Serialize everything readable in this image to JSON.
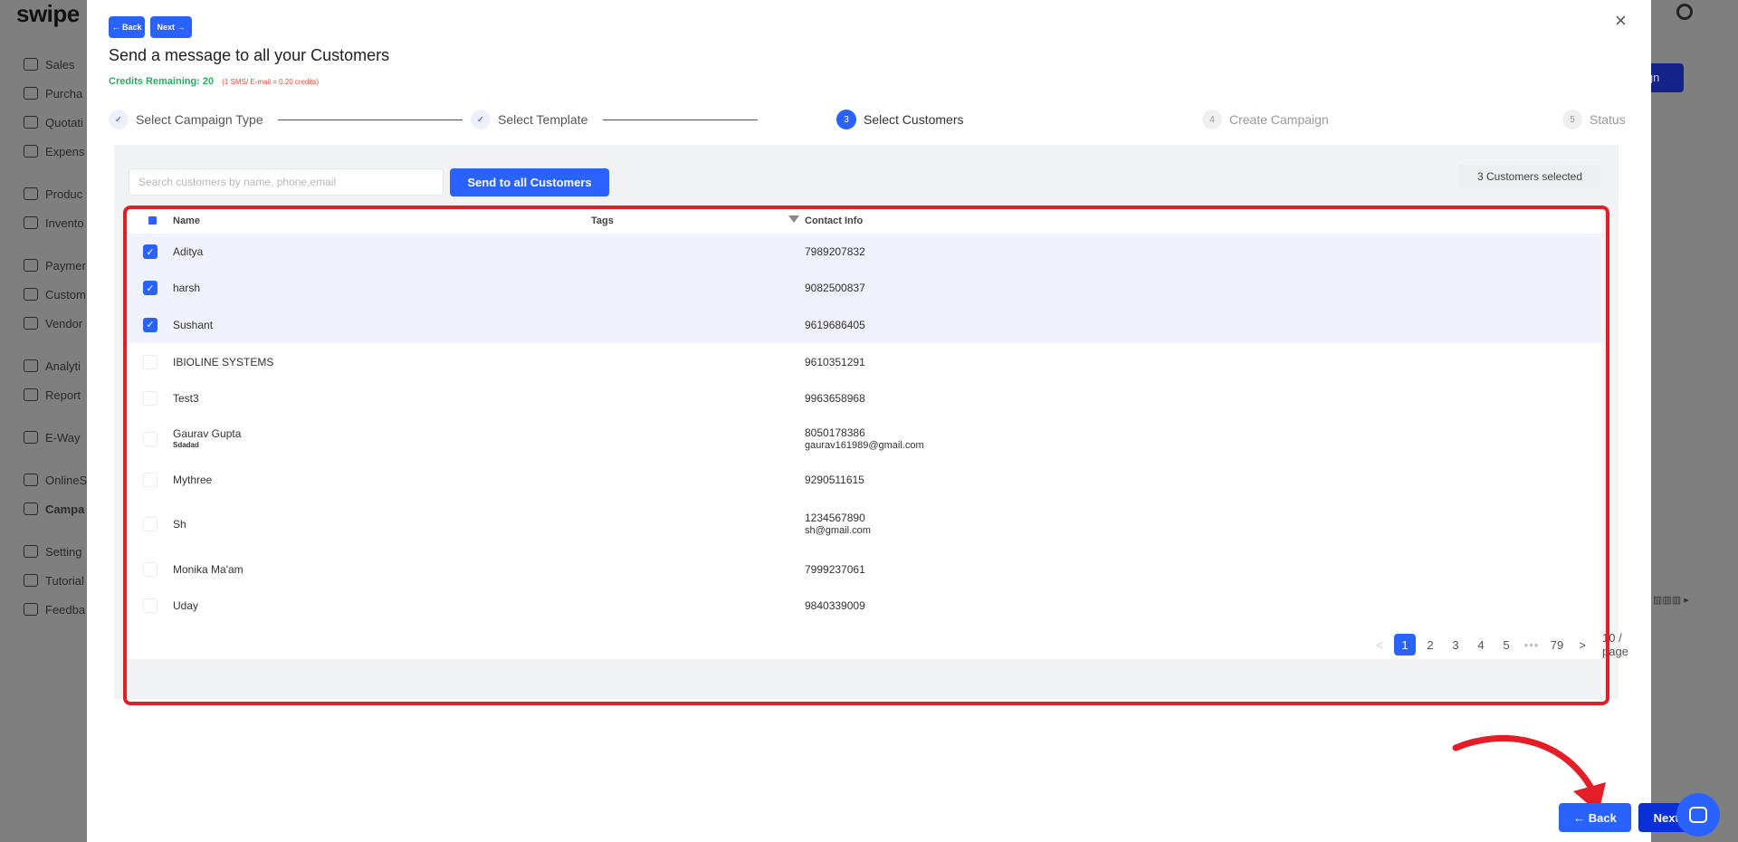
{
  "app": {
    "logo": "swipe :"
  },
  "sidebar": {
    "items": [
      {
        "label": "Sales",
        "icon": "sales-icon"
      },
      {
        "label": "Purcha",
        "icon": "cart-icon"
      },
      {
        "label": "Quotati",
        "icon": "pen-icon"
      },
      {
        "label": "Expens",
        "icon": "tag-icon"
      },
      {
        "label": "Produc",
        "icon": "scan-icon"
      },
      {
        "label": "Invento",
        "icon": "inventory-icon"
      },
      {
        "label": "Paymer",
        "icon": "rupee-icon"
      },
      {
        "label": "Custom",
        "icon": "user-icon"
      },
      {
        "label": "Vendor",
        "icon": "users-icon"
      },
      {
        "label": "Analyti",
        "icon": "chart-icon"
      },
      {
        "label": "Report",
        "icon": "report-icon"
      },
      {
        "label": "E-Way",
        "icon": "truck-icon"
      },
      {
        "label": "OnlineS",
        "icon": "store-icon"
      },
      {
        "label": "Campa",
        "icon": "megaphone-icon"
      },
      {
        "label": "Setting",
        "icon": "gear-icon"
      },
      {
        "label": "Tutorial",
        "icon": "youtube-icon"
      },
      {
        "label": "Feedba",
        "icon": "feedback-icon"
      }
    ]
  },
  "background": {
    "right_button_label": "ign"
  },
  "modal": {
    "top_back_label": "← Back",
    "top_next_label": "Next →",
    "close_label": "×",
    "title": "Send a message to all your Customers",
    "credits_label": "Credits Remaining: 20",
    "credits_note": "(1 SMS/ E-mail = 0.20 credits)",
    "steps": [
      {
        "label": "Select Campaign Type",
        "marker": "✓",
        "status": "done"
      },
      {
        "label": "Select Template",
        "marker": "✓",
        "status": "done"
      },
      {
        "label": "Select Customers",
        "marker": "3",
        "status": "active"
      },
      {
        "label": "Create Campaign",
        "marker": "4",
        "status": "todo"
      },
      {
        "label": "Status",
        "marker": "5",
        "status": "todo"
      }
    ],
    "search_placeholder": "Search customers by name, phone,email",
    "send_all_label": "Send to all Customers",
    "selected_count_label": "3 Customers selected",
    "table": {
      "headers": {
        "name": "Name",
        "tags": "Tags",
        "contact": "Contact Info"
      },
      "rows": [
        {
          "name": "Aditya",
          "tag": "",
          "phone": "7989207832",
          "email": "",
          "checked": true
        },
        {
          "name": "harsh",
          "tag": "",
          "phone": "9082500837",
          "email": "",
          "checked": true
        },
        {
          "name": "Sushant",
          "tag": "",
          "phone": "9619686405",
          "email": "",
          "checked": true
        },
        {
          "name": "IBIOLINE SYSTEMS",
          "tag": "",
          "phone": "9610351291",
          "email": "",
          "checked": false
        },
        {
          "name": "Test3",
          "tag": "",
          "phone": "9963658968",
          "email": "",
          "checked": false
        },
        {
          "name": "Gaurav Gupta",
          "tag": "Sdadad",
          "phone": "8050178386",
          "email": "gaurav161989@gmail.com",
          "checked": false
        },
        {
          "name": "Mythree",
          "tag": "",
          "phone": "9290511615",
          "email": "",
          "checked": false
        },
        {
          "name": "Sh",
          "tag": "",
          "phone": "1234567890",
          "email": "sh@gmail.com",
          "checked": false
        },
        {
          "name": "Monika Ma'am",
          "tag": "",
          "phone": "7999237061",
          "email": "",
          "checked": false
        },
        {
          "name": "Uday",
          "tag": "",
          "phone": "9840339009",
          "email": "",
          "checked": false
        }
      ]
    },
    "pagination": {
      "prev": "<",
      "pages": [
        "1",
        "2",
        "3",
        "4",
        "5"
      ],
      "current": "1",
      "ellipsis": "•••",
      "last": "79",
      "next": ">",
      "page_size": "10 / page"
    },
    "bottom_back_label": "← Back",
    "bottom_next_label": "Next →"
  },
  "colors": {
    "primary": "#2962ff",
    "annotation": "#e41e26",
    "credits": "#27ae60"
  }
}
